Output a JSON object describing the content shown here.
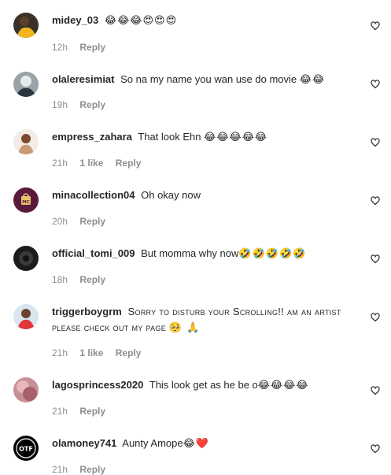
{
  "comments": [
    {
      "username": "midey_03",
      "text": "",
      "emoji": "😂😂😂😍😍😍",
      "time": "12h",
      "likes": "",
      "reply": "Reply"
    },
    {
      "username": "olaleresimiat",
      "text": "So na my name you wan use do movie ",
      "emoji": "😂😂",
      "time": "19h",
      "likes": "",
      "reply": "Reply"
    },
    {
      "username": "empress_zahara",
      "text": "That look Ehn ",
      "emoji": "😂😂😂😂😂",
      "time": "21h",
      "likes": "1 like",
      "reply": "Reply"
    },
    {
      "username": "minacollection04",
      "text": "Oh okay now",
      "emoji": "",
      "time": "20h",
      "likes": "",
      "reply": "Reply"
    },
    {
      "username": "official_tomi_009",
      "text": "But momma why now",
      "emoji": "🤣🤣🤣🤣🤣",
      "time": "18h",
      "likes": "",
      "reply": "Reply"
    },
    {
      "username": "triggerboygrm",
      "text": "Sorry to disturb your Scrolling!! am an artist please check out my page",
      "emoji": "🥺 🙏",
      "time": "21h",
      "likes": "1 like",
      "reply": "Reply"
    },
    {
      "username": "lagosprincess2020",
      "text": "This look get as he be o",
      "emoji": "😂😂😂😂",
      "time": "21h",
      "likes": "",
      "reply": "Reply"
    },
    {
      "username": "olamoney741",
      "text": "Aunty Amope",
      "emoji": "😂❤️",
      "time": "21h",
      "likes": "",
      "reply": "Reply"
    }
  ],
  "avatars": {
    "minacollection04": "MC",
    "olamoney741": "OTF"
  },
  "colors": {
    "text": "#262626",
    "meta": "#8e8e8e",
    "background": "#ffffff"
  }
}
